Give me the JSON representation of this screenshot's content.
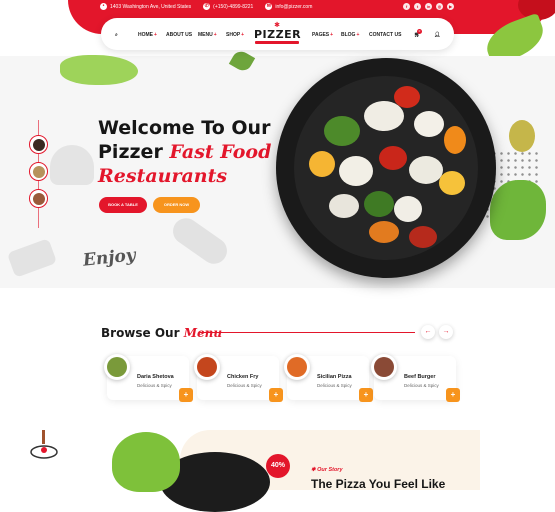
{
  "topbar": {
    "address": "1403 Washington Ave, United States",
    "phone": "(+150)-4899-8221",
    "email": "info@pizzer.com",
    "socials": [
      "facebook-icon",
      "twitter-icon",
      "linkedin-icon",
      "instagram-icon",
      "youtube-icon"
    ]
  },
  "nav": {
    "items": [
      "HOME",
      "ABOUT US",
      "MENU",
      "SHOP",
      "PAGES",
      "BLOG",
      "CONTACT US"
    ],
    "plus": "+",
    "cart_count": "0"
  },
  "logo": {
    "text": "PIZZER"
  },
  "hero": {
    "title_line1": "Welcome To Our",
    "title_brand": "Pizzer",
    "title_red1": "Fast Food",
    "title_amp": "&",
    "title_red2": "Restaurants",
    "book_button": "BOOK A TABLE",
    "order_button": "ORDER NOW",
    "enjoy": "Enjoy"
  },
  "browse": {
    "title_black": "Browse Our",
    "title_red": "Menu",
    "prev": "←",
    "next": "→",
    "items": [
      {
        "name": "Daria Shetova",
        "sub": "Delicious & Spicy",
        "color": "#7a9a3a"
      },
      {
        "name": "Chicken Fry",
        "sub": "Delicious & Spicy",
        "color": "#c4461d"
      },
      {
        "name": "Sicilian Pizza",
        "sub": "Delicious & Spicy",
        "color": "#e06b26"
      },
      {
        "name": "Beef Burger",
        "sub": "Delicious & Spicy",
        "color": "#8a4a36"
      }
    ],
    "plus": "+"
  },
  "story": {
    "badge": "40%",
    "label": "Our Story",
    "title": "The Pizza You Feel Like"
  },
  "colors": {
    "accent": "#e3162b",
    "orange": "#f7941d"
  }
}
